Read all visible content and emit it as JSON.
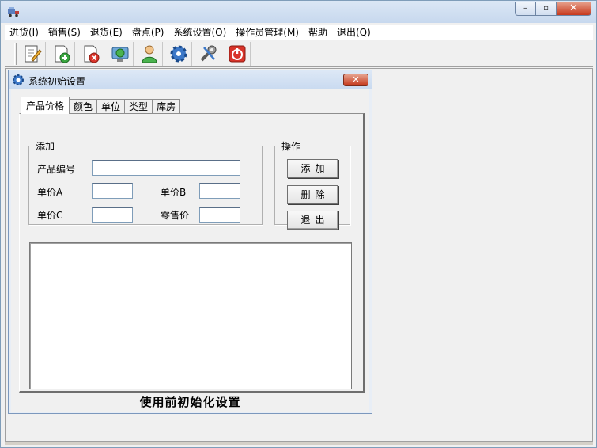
{
  "window": {
    "title": "",
    "controls": {
      "minimize": "–",
      "maximize": "▫",
      "close": "✕"
    }
  },
  "menu": {
    "items": [
      {
        "label": "进货(I)"
      },
      {
        "label": "销售(S)"
      },
      {
        "label": "退货(E)"
      },
      {
        "label": "盘点(P)"
      },
      {
        "label": "系统设置(O)"
      },
      {
        "label": "操作员管理(M)"
      },
      {
        "label": "帮助"
      },
      {
        "label": "退出(Q)"
      }
    ]
  },
  "toolbar": {
    "buttons": [
      {
        "icon": "edit-document-icon"
      },
      {
        "icon": "document-add-icon"
      },
      {
        "icon": "document-delete-icon"
      },
      {
        "icon": "monitor-icon"
      },
      {
        "icon": "user-icon"
      },
      {
        "icon": "gear-icon"
      },
      {
        "icon": "tools-icon"
      },
      {
        "icon": "power-icon"
      }
    ]
  },
  "dialog": {
    "title": "系统初始设置",
    "close": "✕",
    "tabs": [
      {
        "label": "产品价格",
        "active": true
      },
      {
        "label": "颜色",
        "active": false
      },
      {
        "label": "单位",
        "active": false
      },
      {
        "label": "类型",
        "active": false
      },
      {
        "label": "库房",
        "active": false
      }
    ],
    "add_group": {
      "legend": "添加",
      "product_code_label": "产品编号",
      "product_code_value": "",
      "price_a_label": "单价A",
      "price_a_value": "",
      "price_b_label": "单价B",
      "price_b_value": "",
      "price_c_label": "单价C",
      "price_c_value": "",
      "retail_label": "零售价",
      "retail_value": ""
    },
    "op_group": {
      "legend": "操作",
      "add_button": "添加",
      "delete_button": "删除",
      "exit_button": "退出"
    },
    "footer": "使用前初始化设置"
  },
  "colors": {
    "title_bar": "#c7d8ee",
    "close_red": "#c73a1e",
    "panel": "#f0f0f0"
  }
}
